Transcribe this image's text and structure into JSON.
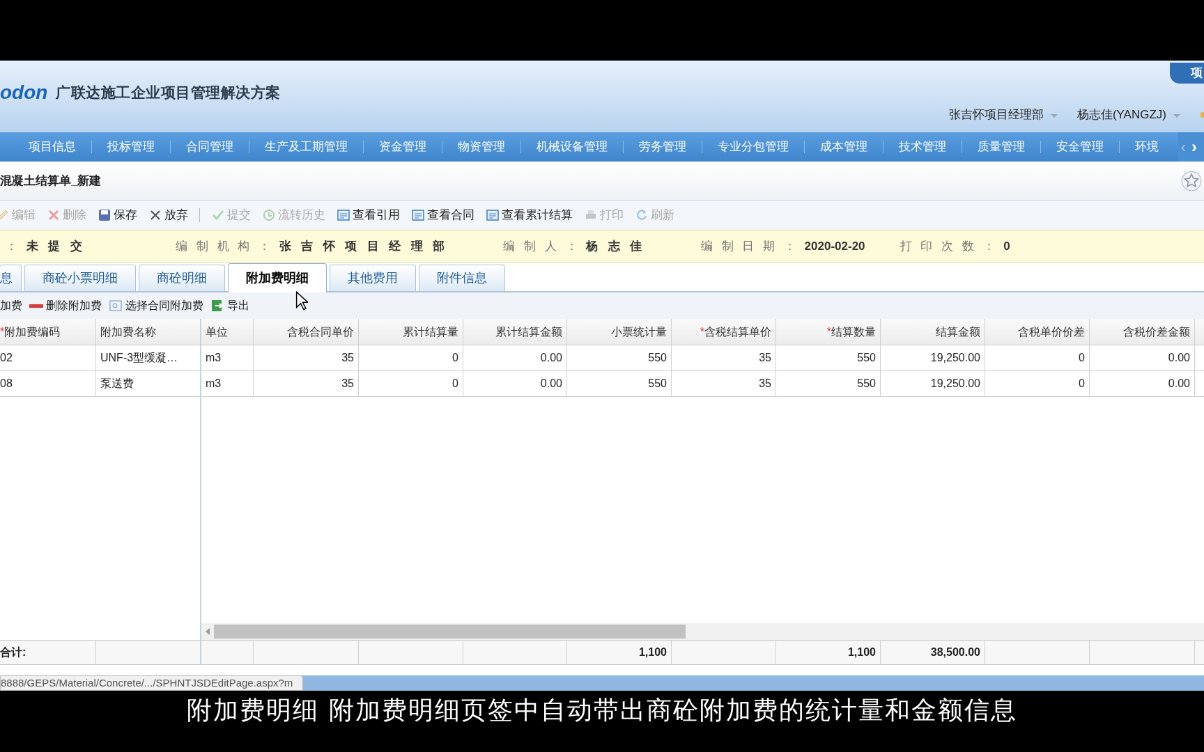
{
  "header": {
    "logo": "odon",
    "product": "广联达施工企业项目管理解决方案",
    "corner_tab": "项",
    "org": "张吉怀项目经理部",
    "user": "杨志佳(YANGZJ)"
  },
  "nav": [
    {
      "label": "项目信息"
    },
    {
      "label": "投标管理"
    },
    {
      "label": "合同管理"
    },
    {
      "label": "生产及工期管理"
    },
    {
      "label": "资金管理"
    },
    {
      "label": "物资管理"
    },
    {
      "label": "机械设备管理"
    },
    {
      "label": "劳务管理"
    },
    {
      "label": "专业分包管理"
    },
    {
      "label": "成本管理"
    },
    {
      "label": "技术管理"
    },
    {
      "label": "质量管理"
    },
    {
      "label": "安全管理"
    },
    {
      "label": "环境"
    }
  ],
  "nav_arrows": [
    "‹",
    "›"
  ],
  "page_title": "混凝土结算单_新建",
  "toolbar": [
    {
      "kind": "edit",
      "label": "编辑",
      "disabled": true
    },
    {
      "kind": "delete",
      "label": "删除",
      "disabled": true
    },
    {
      "kind": "save",
      "label": "保存",
      "disabled": false
    },
    {
      "kind": "discard",
      "label": "放弃",
      "disabled": false
    },
    {
      "kind": "submit",
      "label": "提交",
      "disabled": true
    },
    {
      "kind": "history",
      "label": "流转历史",
      "disabled": true
    },
    {
      "kind": "doc",
      "label": "查看引用",
      "disabled": false
    },
    {
      "kind": "doc",
      "label": "查看合同",
      "disabled": false
    },
    {
      "kind": "doc",
      "label": "查看累计结算",
      "disabled": false
    },
    {
      "kind": "print",
      "label": "打印",
      "disabled": true
    },
    {
      "kind": "refresh",
      "label": "刷新",
      "disabled": true
    }
  ],
  "info": [
    {
      "label": "：",
      "value": "未提交"
    },
    {
      "label": "编制机构：",
      "value": "张吉怀项目经理部"
    },
    {
      "label": "编制人：",
      "value": "杨志佳"
    },
    {
      "label": "编制日期：",
      "value": "2020-02-20"
    },
    {
      "label": "打印次数：",
      "value": "0"
    }
  ],
  "tabs": [
    {
      "label": "息",
      "selected": false
    },
    {
      "label": "商砼小票明细",
      "selected": false
    },
    {
      "label": "商砼明细",
      "selected": false
    },
    {
      "label": "附加费明细",
      "selected": true
    },
    {
      "label": "其他费用",
      "selected": false
    },
    {
      "label": "附件信息",
      "selected": false
    }
  ],
  "subtoolbar": [
    {
      "kind": "add",
      "label": "加费"
    },
    {
      "kind": "remove",
      "label": "删除附加费"
    },
    {
      "kind": "select",
      "label": "选择合同附加费"
    },
    {
      "kind": "export",
      "label": "导出"
    }
  ],
  "table": {
    "columns": [
      {
        "label": "附加费编码",
        "mark": "*"
      },
      {
        "label": "附加费名称"
      },
      {
        "label": "单位"
      },
      {
        "label": "含税合同单价"
      },
      {
        "label": "累计结算量"
      },
      {
        "label": "累计结算金额"
      },
      {
        "label": "小票统计量",
        "total": "1,100"
      },
      {
        "label": "含税结算单价",
        "mark": "*"
      },
      {
        "label": "结算数量",
        "mark": "*",
        "total": "1,100"
      },
      {
        "label": "结算金额",
        "total": "38,500.00"
      },
      {
        "label": "含税单价价差"
      },
      {
        "label": "含税价差金额"
      }
    ],
    "rows": [
      [
        "02",
        "UNF-3型缓凝…",
        "m3",
        "35",
        "0",
        "0.00",
        "550",
        "35",
        "550",
        "19,250.00",
        "0",
        "0.00"
      ],
      [
        "08",
        "泵送费",
        "m3",
        "35",
        "0",
        "0.00",
        "550",
        "35",
        "550",
        "19,250.00",
        "0",
        "0.00"
      ]
    ],
    "totals_label": "合计:"
  },
  "status_url": "8888/GEPS/Material/Concrete/.../SPHNTJSDEditPage.aspx?m",
  "caption": "附加费明细  附加费明细页签中自动带出商砼附加费的统计量和金额信息"
}
